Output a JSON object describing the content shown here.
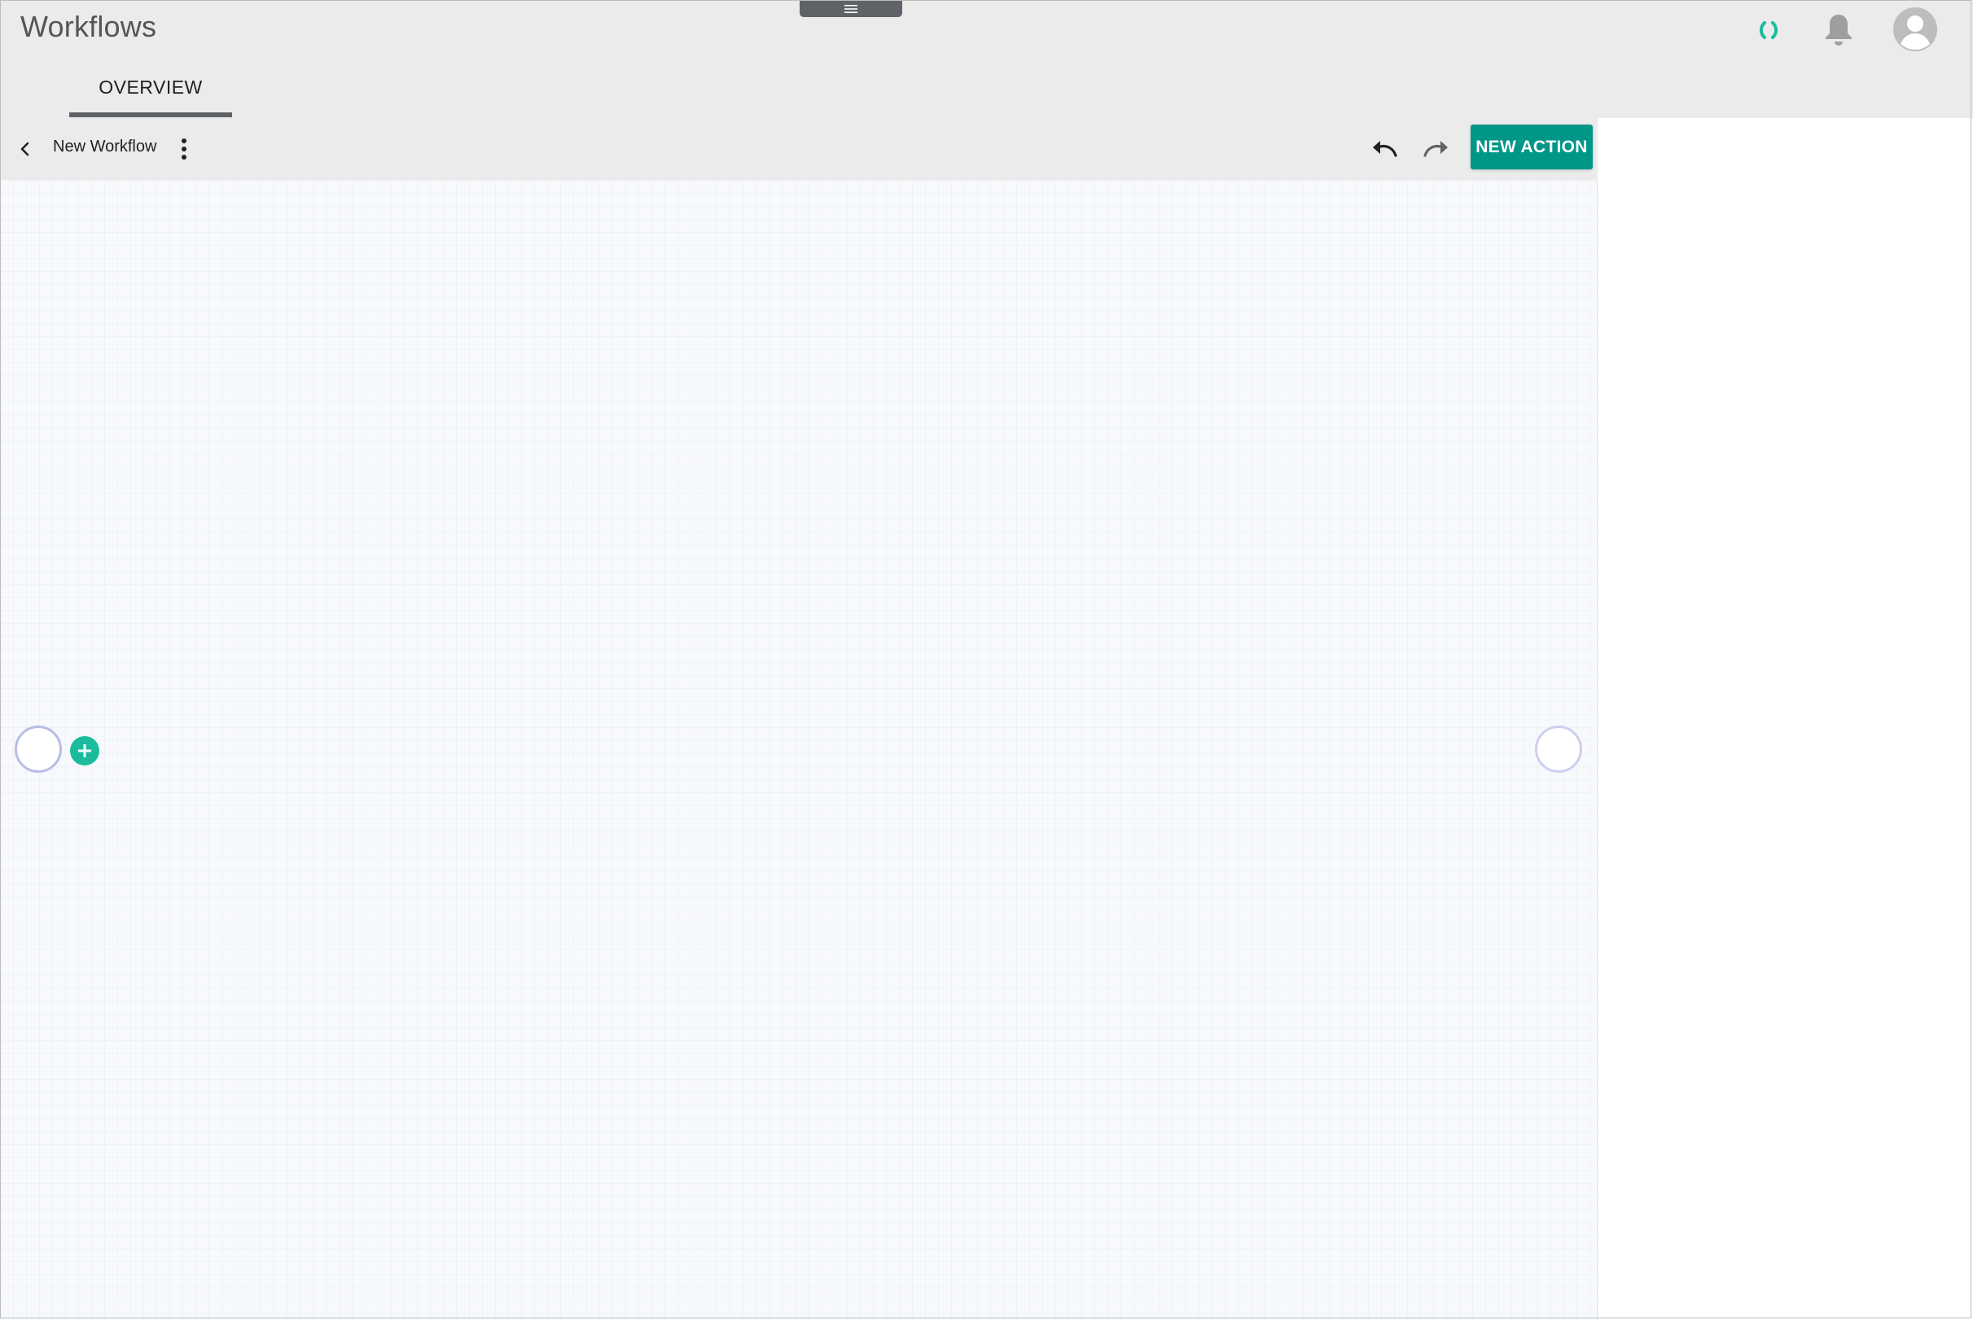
{
  "header": {
    "title": "Workflows",
    "menu_handle_icon": "hamburger-icon",
    "icons": [
      "sync-status-icon",
      "bell-icon",
      "user-avatar-icon"
    ],
    "accent_color": "#1abc9c"
  },
  "tabs": [
    {
      "label": "OVERVIEW",
      "active": true
    }
  ],
  "editor": {
    "back_icon": "chevron-left-icon",
    "workflow_name": "New Workflow",
    "more_icon": "vertical-dots-icon",
    "undo_icon": "undo-icon",
    "redo_icon": "redo-icon",
    "new_action_label": "NEW ACTION",
    "new_action_color": "#009688"
  },
  "canvas": {
    "start_node": "start-node",
    "add_node_icon": "plus-icon",
    "end_node": "end-node"
  }
}
